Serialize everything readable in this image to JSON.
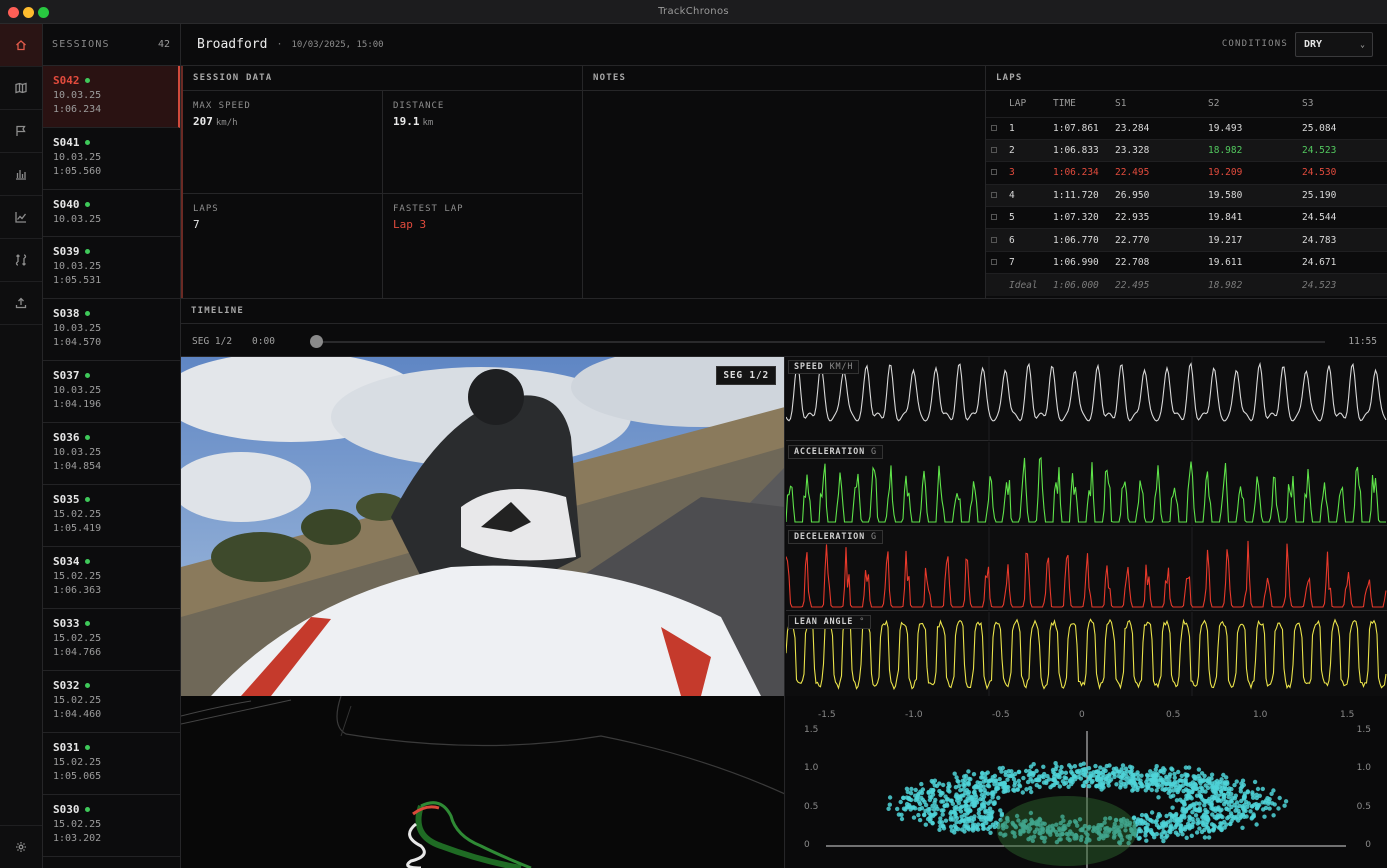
{
  "window": {
    "title": "TrackChronos"
  },
  "sessions": {
    "header": "SESSIONS",
    "count": "42",
    "items": [
      {
        "id": "S042",
        "date": "10.03.25",
        "time": "1:06.234"
      },
      {
        "id": "S041",
        "date": "10.03.25",
        "time": "1:05.560"
      },
      {
        "id": "S040",
        "date": "10.03.25",
        "time": ""
      },
      {
        "id": "S039",
        "date": "10.03.25",
        "time": "1:05.531"
      },
      {
        "id": "S038",
        "date": "10.03.25",
        "time": "1:04.570"
      },
      {
        "id": "S037",
        "date": "10.03.25",
        "time": "1:04.196"
      },
      {
        "id": "S036",
        "date": "10.03.25",
        "time": "1:04.854"
      },
      {
        "id": "S035",
        "date": "15.02.25",
        "time": "1:05.419"
      },
      {
        "id": "S034",
        "date": "15.02.25",
        "time": "1:06.363"
      },
      {
        "id": "S033",
        "date": "15.02.25",
        "time": "1:04.766"
      },
      {
        "id": "S032",
        "date": "15.02.25",
        "time": "1:04.460"
      },
      {
        "id": "S031",
        "date": "15.02.25",
        "time": "1:05.065"
      },
      {
        "id": "S030",
        "date": "15.02.25",
        "time": "1:03.202"
      }
    ]
  },
  "header": {
    "track": "Broadford",
    "separator": "·",
    "datetime": "10/03/2025, 15:00",
    "conditions_label": "CONDITIONS",
    "conditions_value": "DRY"
  },
  "session_data": {
    "title": "SESSION DATA",
    "max_speed_label": "MAX SPEED",
    "max_speed": "207",
    "max_speed_unit": "km/h",
    "distance_label": "DISTANCE",
    "distance": "19.1",
    "distance_unit": "km",
    "laps_label": "LAPS",
    "laps": "7",
    "fastest_label": "FASTEST LAP",
    "fastest": "Lap 3"
  },
  "notes": {
    "title": "NOTES"
  },
  "laps": {
    "title": "LAPS",
    "columns": [
      "LAP",
      "TIME",
      "S1",
      "S2",
      "S3"
    ],
    "rows": [
      [
        "1",
        "1:07.861",
        "23.284",
        "19.493",
        "25.084"
      ],
      [
        "2",
        "1:06.833",
        "23.328",
        "18.982",
        "24.523"
      ],
      [
        "3",
        "1:06.234",
        "22.495",
        "19.209",
        "24.530"
      ],
      [
        "4",
        "1:11.720",
        "26.950",
        "19.580",
        "25.190"
      ],
      [
        "5",
        "1:07.320",
        "22.935",
        "19.841",
        "24.544"
      ],
      [
        "6",
        "1:06.770",
        "22.770",
        "19.217",
        "24.783"
      ],
      [
        "7",
        "1:06.990",
        "22.708",
        "19.611",
        "24.671"
      ]
    ],
    "ideal": [
      "Ideal",
      "1:06.000",
      "22.495",
      "18.982",
      "24.523"
    ]
  },
  "timeline": {
    "title": "TIMELINE",
    "segment": "SEG 1/2",
    "start": "0:00",
    "end": "11:55",
    "position_fraction": 0.0
  },
  "video": {
    "badge": "SEG 1/2"
  },
  "charts": [
    {
      "label": "SPEED",
      "unit": "KM/H",
      "color": "#d8d8d8"
    },
    {
      "label": "ACCELERATION",
      "unit": "G",
      "color": "#5fe34a"
    },
    {
      "label": "DECELERATION",
      "unit": "G",
      "color": "#e8392b"
    },
    {
      "label": "LEAN ANGLE",
      "unit": "°",
      "color": "#e9e24a"
    }
  ],
  "gg_plot": {
    "x_ticks": [
      "-1.5",
      "-1.0",
      "-0.5",
      "0",
      "0.5",
      "1.0",
      "1.5"
    ],
    "y_ticks": [
      "1.5",
      "1.0",
      "0.5",
      "0"
    ],
    "color": "#4fd3d8"
  }
}
